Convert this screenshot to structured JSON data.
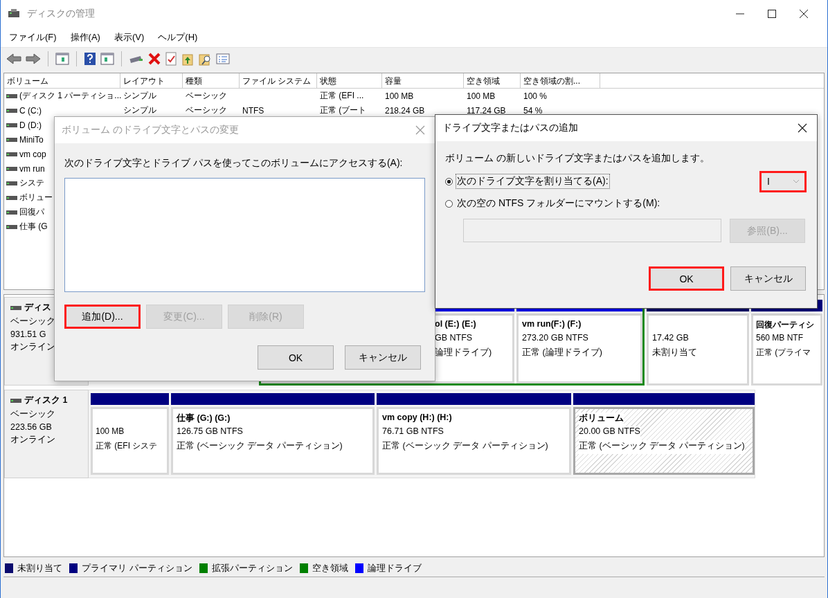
{
  "window": {
    "title": "ディスクの管理"
  },
  "menu": [
    "ファイル(F)",
    "操作(A)",
    "表示(V)",
    "ヘルプ(H)"
  ],
  "volume_list": {
    "columns": [
      "ボリューム",
      "レイアウト",
      "種類",
      "ファイル システム",
      "状態",
      "容量",
      "空き領域",
      "空き領域の割..."
    ],
    "rows": [
      {
        "volume": "(ディスク 1 パーティショ...",
        "layout": "シンプル",
        "type": "ベーシック",
        "status": "正常 (EFI ...",
        "capacity": "100 MB",
        "free_space": "100 MB",
        "percent_free": "100 %"
      },
      {
        "volume": "C (C:)",
        "layout": "シンプル",
        "type": "ベーシック",
        "file_system": "NTFS",
        "status": "正常 (ブート",
        "capacity": "218.24 GB",
        "free_space": "117.24 GB",
        "percent_free": "54 %"
      },
      {
        "volume": "D (D:)"
      },
      {
        "volume": "MiniTo"
      },
      {
        "volume": "vm cop"
      },
      {
        "volume": "vm run"
      },
      {
        "volume": "システ"
      },
      {
        "volume": "ボリュー"
      },
      {
        "volume": "回復パ"
      },
      {
        "volume": "仕事 (G"
      }
    ]
  },
  "disks": [
    {
      "name": "ディス",
      "type": "ベーシック",
      "size": "931.51 G",
      "status": "オンライン",
      "partitions": [
        {
          "kind": "extended",
          "selected": false,
          "children": [
            {
              "kind": "logical",
              "selected": false,
              "title": "ol (E:)  (E:)",
              "size": "GB NTFS",
              "status": "論理ドライブ)"
            },
            {
              "kind": "logical",
              "selected": false,
              "title": "vm run(F:)  (F:)",
              "size": "273.20 GB NTFS",
              "status": "正常 (論理ドライブ)"
            }
          ]
        },
        {
          "kind": "unallocated",
          "selected": false,
          "size": "17.42 GB",
          "status": "未割り当て"
        },
        {
          "kind": "primary",
          "selected": false,
          "title": "回復パーティシ",
          "size": "560 MB NTF",
          "status": "正常 (プライマ"
        }
      ]
    },
    {
      "name": "ディスク 1",
      "type": "ベーシック",
      "size": "223.56 GB",
      "status": "オンライン",
      "partitions": [
        {
          "kind": "primary",
          "selected": false,
          "size": "100 MB",
          "status": "正常 (EFI システ"
        },
        {
          "kind": "primary",
          "selected": false,
          "title": "仕事 (G:)  (G:)",
          "size": "126.75 GB NTFS",
          "status": "正常 (ベーシック データ パーティション)"
        },
        {
          "kind": "primary",
          "selected": false,
          "title": "vm copy (H:)  (H:)",
          "size": "76.71 GB NTFS",
          "status": "正常 (ベーシック データ パーティション)"
        },
        {
          "kind": "primary",
          "selected": true,
          "title": "ボリューム",
          "size": "20.00 GB NTFS",
          "status": "正常 (ベーシック データ パーティション)"
        }
      ]
    }
  ],
  "legend": [
    {
      "label": "未割り当て",
      "color": "#0a0a6e"
    },
    {
      "label": "プライマリ パーティション",
      "color": "#000080"
    },
    {
      "label": "拡張パーティション",
      "color": "#008000"
    },
    {
      "label": "空き領域",
      "color": "#008000"
    },
    {
      "label": "論理ドライブ",
      "color": "#0000ff"
    }
  ],
  "change_dialog": {
    "title": "ボリューム のドライブ文字とパスの変更",
    "active": false,
    "label": "次のドライブ文字とドライブ パスを使ってこのボリュームにアクセスする(A):",
    "buttons": [
      {
        "label": "追加(D)...",
        "disabled": false,
        "highlighted": true
      },
      {
        "label": "変更(C)...",
        "disabled": true,
        "highlighted": false
      },
      {
        "label": "削除(R)",
        "disabled": true,
        "highlighted": false
      }
    ],
    "footer_buttons": [
      {
        "label": "OK"
      },
      {
        "label": "キャンセル"
      }
    ]
  },
  "add_dialog": {
    "title": "ドライブ文字またはパスの追加",
    "active": true,
    "description": "ボリューム の新しいドライブ文字またはパスを追加します。",
    "options": [
      {
        "label": "次のドライブ文字を割り当てる(A):",
        "selected": true
      },
      {
        "label": "次の空の NTFS フォルダーにマウントする(M):",
        "selected": false
      }
    ],
    "drive_letter": {
      "value": "I",
      "highlighted": true
    },
    "folder_field": {
      "disabled": true
    },
    "browse_button": {
      "label": "参照(B)...",
      "disabled": true
    },
    "buttons": [
      {
        "label": "OK",
        "highlighted": true
      },
      {
        "label": "キャンセル",
        "highlighted": false
      }
    ]
  }
}
